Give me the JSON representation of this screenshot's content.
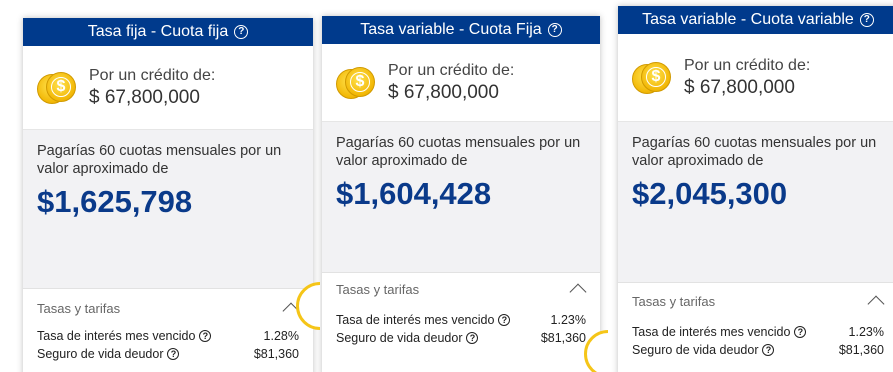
{
  "cards": [
    {
      "title": "Tasa fija - Cuota fija",
      "credit_label": "Por un crédito de:",
      "credit_amount": "$ 67,800,000",
      "pay_text": "Pagarías 60 cuotas mensuales por un valor aproximado de",
      "pay_amount": "$1,625,798",
      "tasas_label": "Tasas y tarifas",
      "rate_label": "Tasa de interés mes vencido",
      "rate_value": "1.28%",
      "insurance_label": "Seguro de vida deudor",
      "insurance_value": "$81,360"
    },
    {
      "title": "Tasa variable - Cuota Fija",
      "credit_label": "Por un crédito de:",
      "credit_amount": "$ 67,800,000",
      "pay_text": "Pagarías 60 cuotas mensuales por un valor aproximado de",
      "pay_amount": "$1,604,428",
      "tasas_label": "Tasas y tarifas",
      "rate_label": "Tasa de interés mes vencido",
      "rate_value": "1.23%",
      "insurance_label": "Seguro de vida deudor",
      "insurance_value": "$81,360"
    },
    {
      "title": "Tasa variable - Cuota variable",
      "credit_label": "Por un crédito de:",
      "credit_amount": "$ 67,800,000",
      "pay_text": "Pagarías 60 cuotas mensuales por un valor aproximado de",
      "pay_amount": "$2,045,300",
      "tasas_label": "Tasas y tarifas",
      "rate_label": "Tasa de interés mes vencido",
      "rate_value": "1.23%",
      "insurance_label": "Seguro de vida deudor",
      "insurance_value": "$81,360"
    }
  ],
  "icons": {
    "help": "question-circle-icon",
    "coins": "gold-coins-icon",
    "expand": "chevron-up-icon"
  },
  "colors": {
    "header_bg": "#003a8c",
    "amount": "#0a3a8a",
    "accent_ring": "#f5c518",
    "pay_bg": "#f2f2f4"
  }
}
